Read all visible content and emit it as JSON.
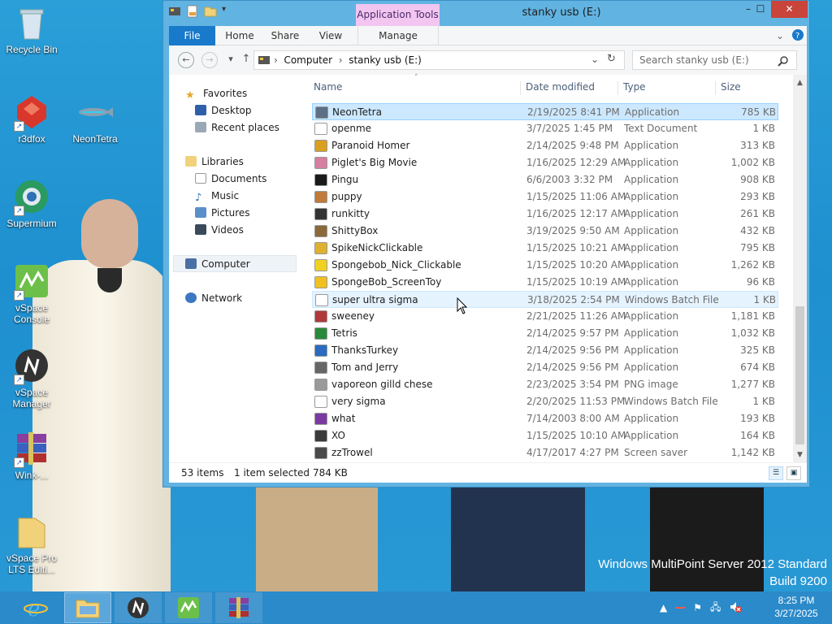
{
  "desktop": {
    "icons": [
      {
        "label": "Recycle Bin"
      },
      {
        "label": "r3dfox"
      },
      {
        "label": "NeonTetra"
      },
      {
        "label": "Supermium"
      },
      {
        "label": "vSpace Console"
      },
      {
        "label": "vSpace Manager"
      },
      {
        "label": "Wink-..."
      },
      {
        "label": "vSpace Pro LTS Editi..."
      }
    ],
    "watermark_line1": "Windows MultiPoint Server 2012 Standard",
    "watermark_line2": "Build 9200"
  },
  "window": {
    "title": "stanky usb (E:)",
    "context_tab": "Application Tools",
    "controls": {
      "minimize": "–",
      "maximize": "☐",
      "close": "✕"
    },
    "ribbon_tabs": [
      "File",
      "Home",
      "Share",
      "View",
      "Manage"
    ],
    "address_crumbs": [
      "Computer",
      "stanky usb (E:)"
    ],
    "search_placeholder": "Search stanky usb (E:)",
    "nav": {
      "favorites": "Favorites",
      "desktop": "Desktop",
      "recent": "Recent places",
      "libraries": "Libraries",
      "documents": "Documents",
      "music": "Music",
      "pictures": "Pictures",
      "videos": "Videos",
      "computer": "Computer",
      "network": "Network"
    },
    "columns": {
      "name": "Name",
      "date": "Date modified",
      "type": "Type",
      "size": "Size"
    },
    "files": [
      {
        "name": "NeonTetra",
        "date": "2/19/2025 8:41 PM",
        "type": "Application",
        "size": "785 KB"
      },
      {
        "name": "openme",
        "date": "3/7/2025 1:45 PM",
        "type": "Text Document",
        "size": "1 KB"
      },
      {
        "name": "Paranoid Homer",
        "date": "2/14/2025 9:48 PM",
        "type": "Application",
        "size": "313 KB"
      },
      {
        "name": "Piglet's Big Movie",
        "date": "1/16/2025 12:29 AM",
        "type": "Application",
        "size": "1,002 KB"
      },
      {
        "name": "Pingu",
        "date": "6/6/2003 3:32 PM",
        "type": "Application",
        "size": "908 KB"
      },
      {
        "name": "puppy",
        "date": "1/15/2025 11:06 AM",
        "type": "Application",
        "size": "293 KB"
      },
      {
        "name": "runkitty",
        "date": "1/16/2025 12:17 AM",
        "type": "Application",
        "size": "261 KB"
      },
      {
        "name": "ShittyBox",
        "date": "3/19/2025 9:50 AM",
        "type": "Application",
        "size": "432 KB"
      },
      {
        "name": "SpikeNickClickable",
        "date": "1/15/2025 10:21 AM",
        "type": "Application",
        "size": "795 KB"
      },
      {
        "name": "Spongebob_Nick_Clickable",
        "date": "1/15/2025 10:20 AM",
        "type": "Application",
        "size": "1,262 KB"
      },
      {
        "name": "SpongeBob_ScreenToy",
        "date": "1/15/2025 10:19 AM",
        "type": "Application",
        "size": "96 KB"
      },
      {
        "name": "super ultra sigma",
        "date": "3/18/2025 2:54 PM",
        "type": "Windows Batch File",
        "size": "1 KB"
      },
      {
        "name": "sweeney",
        "date": "2/21/2025 11:26 AM",
        "type": "Application",
        "size": "1,181 KB"
      },
      {
        "name": "Tetris",
        "date": "2/14/2025 9:57 PM",
        "type": "Application",
        "size": "1,032 KB"
      },
      {
        "name": "ThanksTurkey",
        "date": "2/14/2025 9:56 PM",
        "type": "Application",
        "size": "325 KB"
      },
      {
        "name": "Tom and Jerry",
        "date": "2/14/2025 9:56 PM",
        "type": "Application",
        "size": "674 KB"
      },
      {
        "name": "vaporeon gilld chese",
        "date": "2/23/2025 3:54 PM",
        "type": "PNG image",
        "size": "1,277 KB"
      },
      {
        "name": "very sigma",
        "date": "2/20/2025 11:53 PM",
        "type": "Windows Batch File",
        "size": "1 KB"
      },
      {
        "name": "what",
        "date": "7/14/2003 8:00 AM",
        "type": "Application",
        "size": "193 KB"
      },
      {
        "name": "XO",
        "date": "1/15/2025 10:10 AM",
        "type": "Application",
        "size": "164 KB"
      },
      {
        "name": "zzTrowel",
        "date": "4/17/2017 4:27 PM",
        "type": "Screen saver",
        "size": "1,142 KB"
      }
    ],
    "status": {
      "items": "53 items",
      "selected": "1 item selected",
      "size": "784 KB"
    }
  },
  "taskbar": {
    "time": "8:25 PM",
    "date": "3/27/2025"
  },
  "colors": {
    "accent": "#1979ca",
    "selection": "#cce8ff",
    "taskbar": "#2b8ac9"
  }
}
